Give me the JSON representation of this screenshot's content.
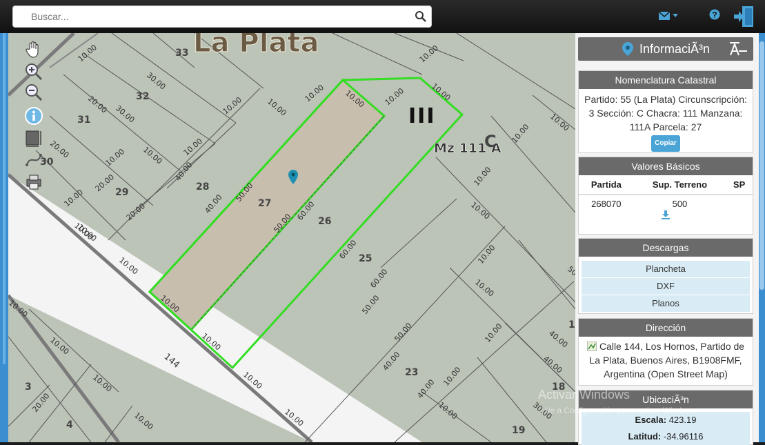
{
  "search": {
    "placeholder": "Buscar..."
  },
  "map": {
    "city_label": "La Plata",
    "block_label": "Mz 111 A",
    "block_number_symbol": "III",
    "block_letter": "C",
    "street_label": "144",
    "parcel_numbers": [
      "33",
      "32",
      "31",
      "30",
      "29",
      "28",
      "27",
      "26",
      "25",
      "23",
      "18",
      "19",
      "3",
      "4",
      "1"
    ],
    "dimension_labels": [
      "10.00",
      "20.00",
      "30.00",
      "40.00",
      "50.00",
      "60.00"
    ]
  },
  "panel": {
    "title": "InformaciÃ³n",
    "nomenclatura": {
      "header": "Nomenclatura Catastral",
      "text": "Partido: 55 (La Plata) Circunscripción: 3 Sección: C Chacra: 111 Manzana: 111A Parcela: 27",
      "copy_label": "Copiar"
    },
    "valores": {
      "header": "Valores Básicos",
      "columns": [
        "Partida",
        "Sup. Terreno",
        "SP"
      ],
      "row": [
        "268070",
        "500",
        ""
      ]
    },
    "descargas": {
      "header": "Descargas",
      "items": [
        "Plancheta",
        "DXF",
        "Planos"
      ]
    },
    "direccion": {
      "header": "Dirección",
      "text": "Calle 144, Los Hornos, Partido de La Plata, Buenos Aires, B1908FMF, Argentina (Open Street Map)"
    },
    "ubicacion": {
      "header": "UbicaciÃ³n",
      "escala_label": "Escala:",
      "escala_value": "423.19",
      "latitud_label": "Latitud:",
      "latitud_value": "-34.96116"
    }
  },
  "watermark": {
    "line1": "Activar Windows",
    "line2": "Ve a Configuración para activar Windows."
  },
  "colors": {
    "accent": "#3b8ed0",
    "panel_header": "#6a6a6a",
    "parcel_highlight": "#33dd22",
    "map_bg": "#bcc3b7"
  }
}
